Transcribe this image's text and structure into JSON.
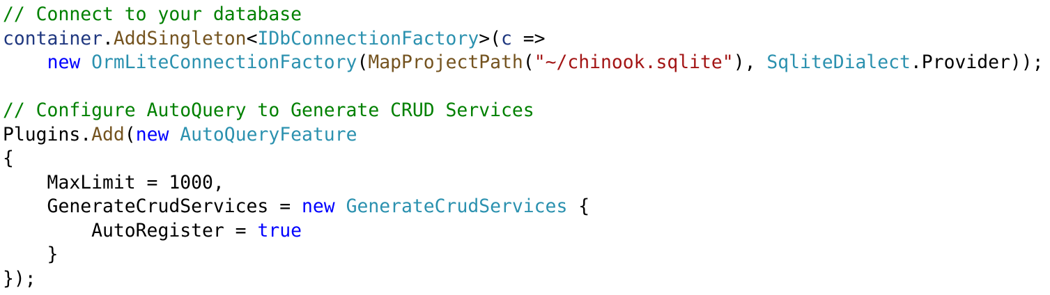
{
  "editor": {
    "colors": {
      "background": "#ffffff",
      "plain": "#000000",
      "comment": "#008000",
      "keyword": "#0000ff",
      "type": "#2b91af",
      "method": "#74531f",
      "string": "#a31515",
      "local": "#1f377f"
    },
    "lines": [
      [
        {
          "t": "// Connect to your database",
          "k": "comment"
        }
      ],
      [
        {
          "t": "container",
          "k": "local"
        },
        {
          "t": ".",
          "k": "plain"
        },
        {
          "t": "AddSingleton",
          "k": "method"
        },
        {
          "t": "<",
          "k": "plain"
        },
        {
          "t": "IDbConnectionFactory",
          "k": "type"
        },
        {
          "t": ">(",
          "k": "plain"
        },
        {
          "t": "c",
          "k": "local"
        },
        {
          "t": " =>",
          "k": "plain"
        }
      ],
      [
        {
          "t": "    ",
          "k": "plain"
        },
        {
          "t": "new",
          "k": "keyword"
        },
        {
          "t": " ",
          "k": "plain"
        },
        {
          "t": "OrmLiteConnectionFactory",
          "k": "type"
        },
        {
          "t": "(",
          "k": "plain"
        },
        {
          "t": "MapProjectPath",
          "k": "method"
        },
        {
          "t": "(",
          "k": "plain"
        },
        {
          "t": "\"~/chinook.sqlite\"",
          "k": "string"
        },
        {
          "t": "), ",
          "k": "plain"
        },
        {
          "t": "SqliteDialect",
          "k": "type"
        },
        {
          "t": ".Provider));",
          "k": "plain"
        }
      ],
      [],
      [
        {
          "t": "// Configure AutoQuery to Generate CRUD Services",
          "k": "comment"
        }
      ],
      [
        {
          "t": "Plugins",
          "k": "plain"
        },
        {
          "t": ".",
          "k": "plain"
        },
        {
          "t": "Add",
          "k": "method"
        },
        {
          "t": "(",
          "k": "plain"
        },
        {
          "t": "new",
          "k": "keyword"
        },
        {
          "t": " ",
          "k": "plain"
        },
        {
          "t": "AutoQueryFeature",
          "k": "type"
        }
      ],
      [
        {
          "t": "{",
          "k": "plain"
        }
      ],
      [
        {
          "t": "    MaxLimit = 1000,",
          "k": "plain"
        }
      ],
      [
        {
          "t": "    GenerateCrudServices = ",
          "k": "plain"
        },
        {
          "t": "new",
          "k": "keyword"
        },
        {
          "t": " ",
          "k": "plain"
        },
        {
          "t": "GenerateCrudServices",
          "k": "type"
        },
        {
          "t": " {",
          "k": "plain"
        }
      ],
      [
        {
          "t": "        AutoRegister = ",
          "k": "plain"
        },
        {
          "t": "true",
          "k": "keyword"
        }
      ],
      [
        {
          "t": "    }",
          "k": "plain"
        }
      ],
      [
        {
          "t": "});",
          "k": "plain"
        }
      ]
    ]
  }
}
